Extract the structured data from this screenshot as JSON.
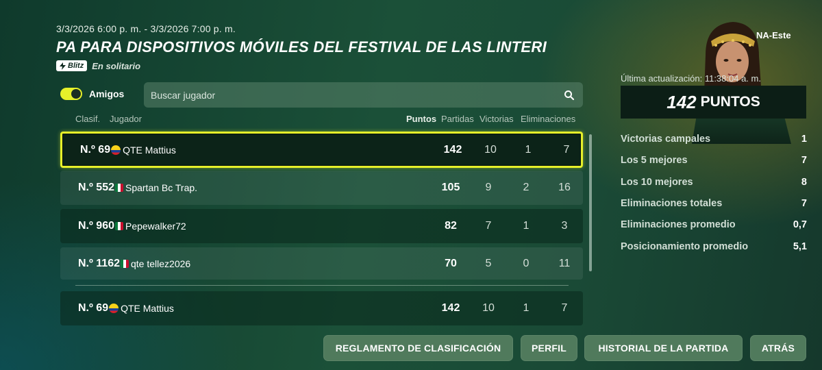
{
  "header": {
    "date_range": "3/3/2026 6:00 p. m. - 3/3/2026 7:00 p. m.",
    "title": "PA PARA DISPOSITIVOS MÓVILES DEL FESTIVAL DE LAS LINTERI",
    "mode_badge": "Blitz",
    "mode_text": "En solitario"
  },
  "filters": {
    "friends_label": "Amigos",
    "friends_enabled": true,
    "search_placeholder": "Buscar jugador"
  },
  "columns": {
    "rank": "Clasif.",
    "player": "Jugador",
    "points": "Puntos",
    "matches": "Partidas",
    "wins": "Victorias",
    "eliminations": "Eliminaciones"
  },
  "rows": [
    {
      "rank": "N.º 69",
      "flag": "colombia-flag",
      "name": "QTE Mattius",
      "points": "142",
      "matches": "10",
      "wins": "1",
      "elims": "7"
    },
    {
      "rank": "N.º 552",
      "flag": "mexico-flag",
      "name": "Spartan Bc Trap.",
      "points": "105",
      "matches": "9",
      "wins": "2",
      "elims": "16"
    },
    {
      "rank": "N.º 960",
      "flag": "mexico-flag",
      "name": "Pepewalker72",
      "points": "82",
      "matches": "7",
      "wins": "1",
      "elims": "3"
    },
    {
      "rank": "N.º 1162",
      "flag": "mexico-flag",
      "name": "qte tellez2026",
      "points": "70",
      "matches": "5",
      "wins": "0",
      "elims": "11"
    }
  ],
  "self_row": {
    "rank": "N.º 69",
    "flag": "colombia-flag",
    "name": "QTE Mattius",
    "points": "142",
    "matches": "10",
    "wins": "1",
    "elims": "7"
  },
  "profile": {
    "region": "NA-Este",
    "last_update": "Última actualización: 11:38:04 a. m.",
    "points_value": "142",
    "points_label": "PUNTOS"
  },
  "stats": [
    {
      "label": "Victorias campales",
      "value": "1"
    },
    {
      "label": "Los 5 mejores",
      "value": "7"
    },
    {
      "label": "Los 10 mejores",
      "value": "8"
    },
    {
      "label": "Eliminaciones totales",
      "value": "7"
    },
    {
      "label": "Eliminaciones promedio",
      "value": "0,7"
    },
    {
      "label": "Posicionamiento promedio",
      "value": "5,1"
    }
  ],
  "buttons": {
    "rules": "REGLAMENTO DE CLASIFICACIÓN",
    "profile": "PERFIL",
    "history": "HISTORIAL DE LA PARTIDA",
    "back": "ATRÁS"
  },
  "colors": {
    "accent_yellow": "#e6f02a",
    "button_bg": "#507a5c",
    "row_dark": "#0c2318"
  }
}
